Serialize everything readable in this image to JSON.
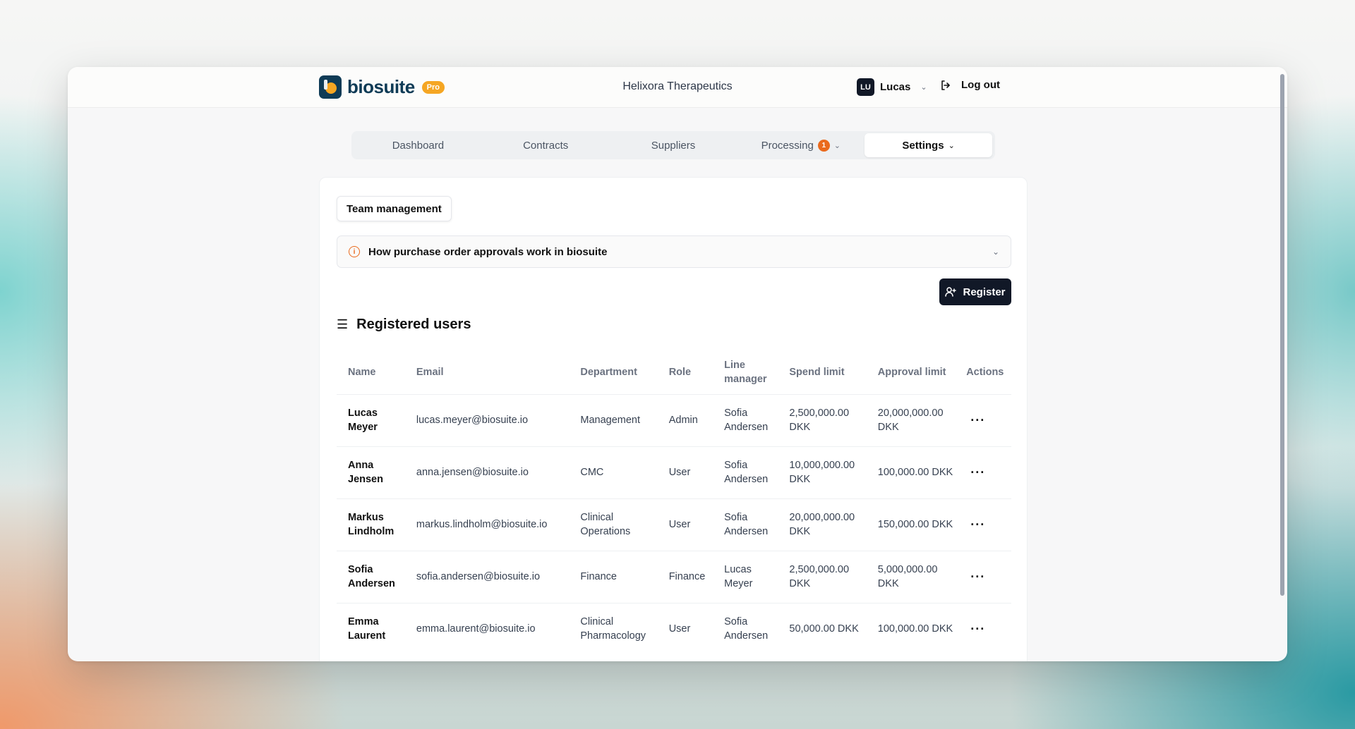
{
  "app": {
    "logo_text": "biosuite",
    "plan_badge": "Pro",
    "company": "Helixora Therapeutics"
  },
  "user": {
    "initials": "LU",
    "name": "Lucas",
    "logout_label": "Log out"
  },
  "nav": {
    "tabs": [
      {
        "label": "Dashboard"
      },
      {
        "label": "Contracts"
      },
      {
        "label": "Suppliers"
      },
      {
        "label": "Processing",
        "badge": "1"
      },
      {
        "label": "Settings",
        "active": true
      }
    ]
  },
  "settings": {
    "subtab": "Team management",
    "info_banner": "How purchase order approvals work in biosuite",
    "register_label": "Register",
    "section_title": "Registered users"
  },
  "table": {
    "headers": {
      "name": "Name",
      "email": "Email",
      "department": "Department",
      "role": "Role",
      "line_manager": "Line manager",
      "spend_limit": "Spend limit",
      "approval_limit": "Approval limit",
      "actions": "Actions"
    },
    "rows": [
      {
        "name": "Lucas Meyer",
        "email": "lucas.meyer@biosuite.io",
        "department": "Management",
        "role": "Admin",
        "line_manager": "Sofia Andersen",
        "spend_limit": "2,500,000.00 DKK",
        "approval_limit": "20,000,000.00 DKK",
        "actions": "···"
      },
      {
        "name": "Anna Jensen",
        "email": "anna.jensen@biosuite.io",
        "department": "CMC",
        "role": "User",
        "line_manager": "Sofia Andersen",
        "spend_limit": "10,000,000.00 DKK",
        "approval_limit": "100,000.00 DKK",
        "actions": "···"
      },
      {
        "name": "Markus Lindholm",
        "email": "markus.lindholm@biosuite.io",
        "department": "Clinical Operations",
        "role": "User",
        "line_manager": "Sofia Andersen",
        "spend_limit": "20,000,000.00 DKK",
        "approval_limit": "150,000.00 DKK",
        "actions": "···"
      },
      {
        "name": "Sofia Andersen",
        "email": "sofia.andersen@biosuite.io",
        "department": "Finance",
        "role": "Finance",
        "line_manager": "Lucas Meyer",
        "spend_limit": "2,500,000.00 DKK",
        "approval_limit": "5,000,000.00 DKK",
        "actions": "···"
      },
      {
        "name": "Emma Laurent",
        "email": "emma.laurent@biosuite.io",
        "department": "Clinical Pharmacology",
        "role": "User",
        "line_manager": "Sofia Andersen",
        "spend_limit": "50,000.00 DKK",
        "approval_limit": "100,000.00 DKK",
        "actions": "···"
      }
    ]
  },
  "colors": {
    "accent": "#ea6a1d",
    "brand": "#0f3b56",
    "primary_button": "#111827"
  }
}
